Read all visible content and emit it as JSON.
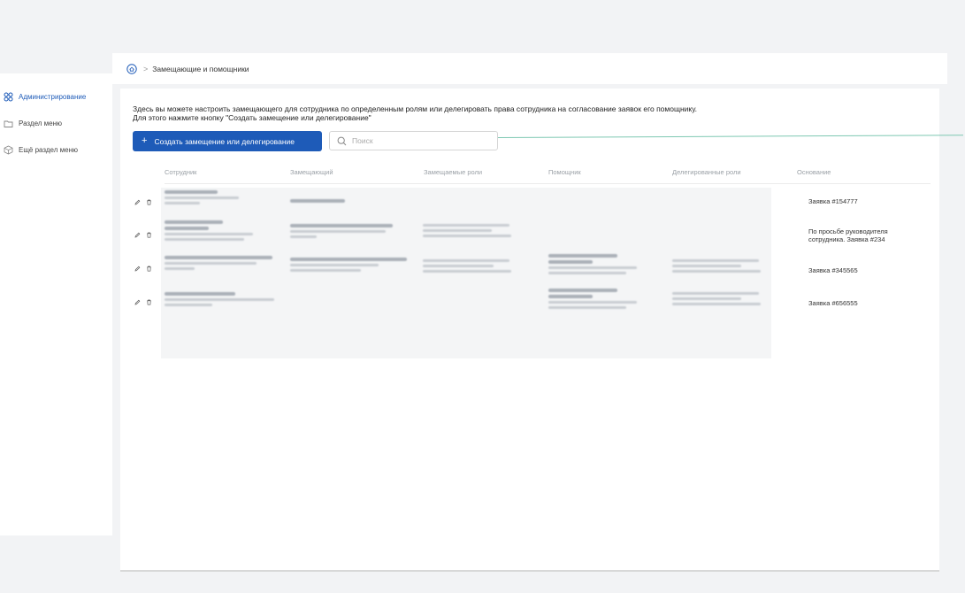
{
  "sidebar": {
    "items": [
      {
        "label": "Администрирование",
        "icon": "grid-icon",
        "active": true
      },
      {
        "label": "Раздел меню",
        "icon": "folder-icon",
        "active": false
      },
      {
        "label": "Ещё раздел меню",
        "icon": "box-icon",
        "active": false
      }
    ]
  },
  "breadcrumb": {
    "home_icon": "home-icon",
    "separator": ">",
    "current": "Замещающие и помощники"
  },
  "main": {
    "description_line1": "Здесь вы можете настроить замещающего для сотрудника по определенным ролям или делегировать права сотрудника на согласование заявок его помощнику.",
    "description_line2": "Для этого нажмите кнопку \"Создать замещение или делегирование\"",
    "create_button_label": "Создать замещение или делегирование",
    "create_button_icon": "plus-icon",
    "search_placeholder": "Поиск"
  },
  "table": {
    "columns": [
      "Сотрудник",
      "Замещающий",
      "Замещаемые роли",
      "Помощник",
      "Делегированные роли",
      "Основание"
    ],
    "rows": [
      {
        "basis": "Заявка #154777"
      },
      {
        "basis": "По просьбе руководителя сотрудника. Заявка #234"
      },
      {
        "basis": "Заявка #345565"
      },
      {
        "basis": "Заявка #656555"
      }
    ]
  },
  "colors": {
    "accent": "#1e5bb8",
    "background": "#f2f3f5",
    "panel": "#ffffff"
  }
}
